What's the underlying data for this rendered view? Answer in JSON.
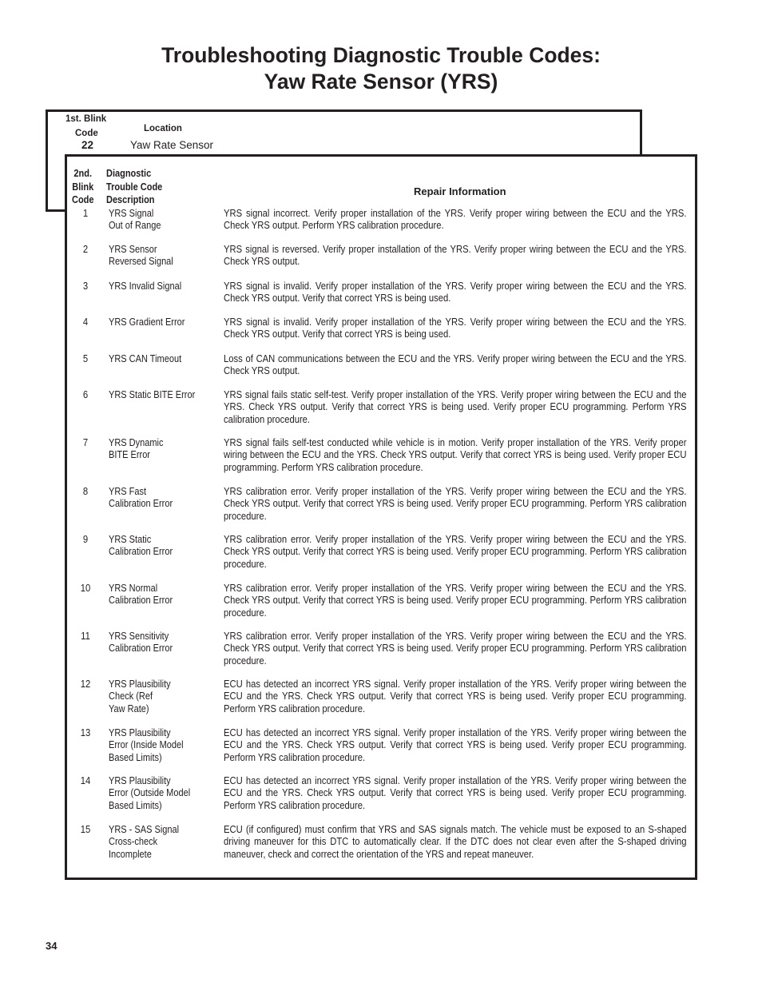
{
  "title": {
    "line1": "Troubleshooting Diagnostic Trouble Codes:",
    "line2": "Yaw Rate Sensor (YRS)"
  },
  "first_blink": {
    "label_line1": "1st. Blink",
    "label_line2": "Code",
    "location_label": "Location",
    "code": "22",
    "location": "Yaw Rate Sensor"
  },
  "table": {
    "headers": {
      "code": [
        "2nd.",
        "Blink",
        "Code"
      ],
      "description": [
        "Diagnostic",
        "Trouble Code",
        "Description"
      ],
      "repair": "Repair Information"
    },
    "rows": [
      {
        "code": "1",
        "description": "YRS Signal\nOut of Range",
        "repair": "YRS signal incorrect. Verify proper installation of the YRS. Verify proper wiring between the ECU and the YRS. Check YRS output. Perform YRS calibration procedure."
      },
      {
        "code": "2",
        "description": "YRS Sensor\nReversed Signal",
        "repair": "YRS signal is reversed. Verify proper installation of the YRS. Verify proper wiring between the ECU and the YRS. Check YRS output."
      },
      {
        "code": "3",
        "description": "YRS Invalid Signal",
        "repair": "YRS signal is invalid. Verify proper installation of the YRS. Verify proper wiring between the ECU and the YRS. Check YRS output. Verify that correct YRS is being used."
      },
      {
        "code": "4",
        "description": "YRS Gradient Error",
        "repair": "YRS signal is invalid. Verify proper installation of the YRS. Verify proper wiring between the ECU and the YRS. Check YRS output. Verify that correct YRS is being used."
      },
      {
        "code": "5",
        "description": "YRS CAN Timeout",
        "repair": "Loss of CAN communications between the ECU and the YRS. Verify proper wiring between the ECU and the YRS. Check YRS output."
      },
      {
        "code": "6",
        "description": "YRS Static BITE Error",
        "repair": "YRS signal fails static self-test. Verify proper installation of the YRS. Verify proper wiring between the ECU and the YRS. Check YRS output. Verify that correct YRS is being used. Verify proper ECU programming. Perform YRS calibration procedure."
      },
      {
        "code": "7",
        "description": "YRS Dynamic\nBITE Error",
        "repair": "YRS signal fails self-test conducted while vehicle is in motion. Verify proper installation of the YRS. Verify proper wiring between the ECU and the YRS. Check YRS output. Verify that correct YRS is being used. Verify proper ECU programming. Perform YRS calibration procedure."
      },
      {
        "code": "8",
        "description": "YRS Fast\nCalibration Error",
        "repair": "YRS calibration error. Verify proper installation of the YRS. Verify proper wiring between the ECU and the YRS. Check YRS output. Verify that correct YRS is being used. Verify proper ECU programming. Perform YRS calibration procedure."
      },
      {
        "code": "9",
        "description": "YRS Static\nCalibration Error",
        "repair": "YRS calibration error. Verify proper installation of the YRS. Verify proper wiring between the ECU and the YRS. Check YRS output. Verify that correct YRS is being used. Verify proper ECU programming. Perform YRS calibration procedure."
      },
      {
        "code": "10",
        "description": "YRS Normal\nCalibration Error",
        "repair": "YRS calibration error. Verify proper installation of the YRS. Verify proper wiring between the ECU and the YRS. Check YRS output. Verify that correct YRS is being used. Verify proper ECU programming. Perform YRS calibration procedure."
      },
      {
        "code": "11",
        "description": "YRS Sensitivity\nCalibration Error",
        "repair": "YRS calibration error. Verify proper installation of the YRS. Verify proper wiring between the ECU and the YRS. Check YRS output. Verify that correct YRS is being used. Verify proper ECU programming. Perform YRS calibration procedure."
      },
      {
        "code": "12",
        "description": "YRS Plausibility\nCheck (Ref\nYaw Rate)",
        "repair": "ECU has detected an incorrect YRS signal. Verify proper installation of the YRS. Verify proper wiring between the ECU and the YRS. Check YRS output. Verify that correct YRS is being used. Verify proper ECU programming. Perform YRS calibration procedure."
      },
      {
        "code": "13",
        "description": "YRS Plausibility\nError (Inside Model\nBased Limits)",
        "repair": "ECU has detected an incorrect YRS signal. Verify proper installation of the YRS. Verify proper wiring between the ECU and the YRS. Check YRS output. Verify that correct YRS is being used. Verify proper ECU programming. Perform YRS calibration procedure."
      },
      {
        "code": "14",
        "description": "YRS Plausibility\nError (Outside Model\nBased Limits)",
        "repair": "ECU has detected an incorrect YRS signal. Verify proper installation of the YRS. Verify proper wiring between the ECU and the YRS. Check YRS output. Verify that correct YRS is being used. Verify proper ECU programming. Perform YRS calibration procedure."
      },
      {
        "code": "15",
        "description": "YRS - SAS Signal\nCross-check\nIncomplete",
        "repair": "ECU (if configured) must confirm that YRS and SAS signals match.  The vehicle must be exposed to an S-shaped driving maneuver for this DTC to automatically clear.  If the DTC does not clear even after the S-shaped driving maneuver, check and correct the orientation of the YRS and repeat maneuver."
      }
    ]
  },
  "page_number": "34"
}
